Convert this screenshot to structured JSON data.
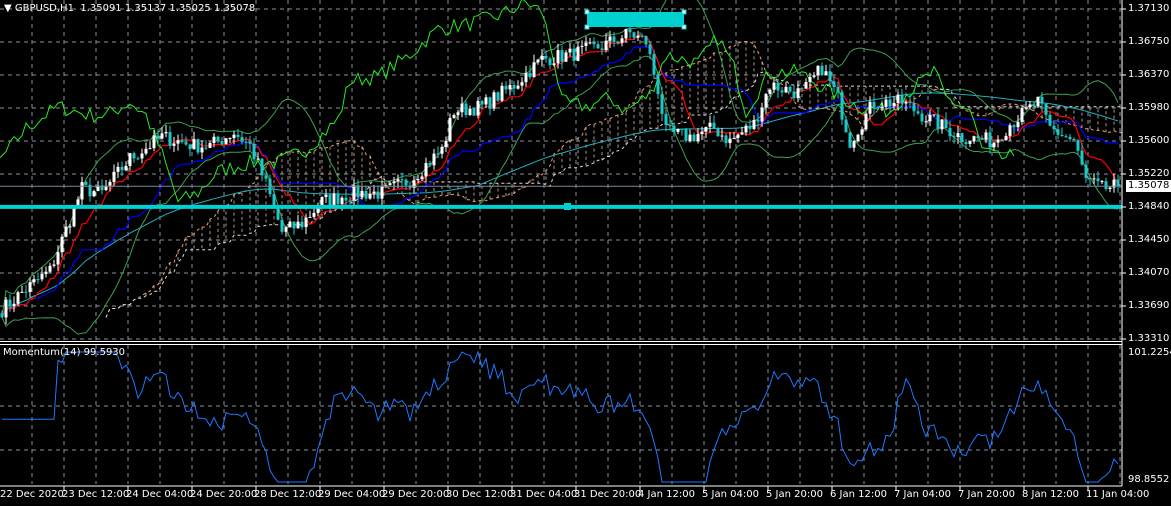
{
  "header": {
    "symbol": "GBPUSD,H1",
    "ohlc": "1.35091 1.35137 1.35025 1.35078",
    "menu_icon": "triangle-down-icon"
  },
  "momentum": {
    "label": "Momentum(14) 99.5930",
    "max_label": "101.2254",
    "min_label": "98.8552"
  },
  "price_axis": {
    "labels": [
      "1.37130",
      "1.36750",
      "1.36370",
      "1.35980",
      "1.35600",
      "1.35220",
      "1.34840",
      "1.34450",
      "1.34070",
      "1.33690",
      "1.33310"
    ],
    "current": "1.35078"
  },
  "time_axis": {
    "labels": [
      "22 Dec 2020",
      "23 Dec 12:00",
      "24 Dec 04:00",
      "24 Dec 20:00",
      "28 Dec 12:00",
      "29 Dec 04:00",
      "29 Dec 20:00",
      "30 Dec 12:00",
      "31 Dec 04:00",
      "31 Dec 20:00",
      "4 Jan 12:00",
      "5 Jan 04:00",
      "5 Jan 20:00",
      "6 Jan 12:00",
      "7 Jan 04:00",
      "7 Jan 20:00",
      "8 Jan 12:00",
      "11 Jan 04:00"
    ]
  },
  "colors": {
    "bull": "#ffffff",
    "bear": "#1ec8c8",
    "grid": "#8a8f99",
    "tenkan": "#ff0000",
    "kijun": "#0000ff",
    "ma_long": "#20b0c0",
    "bands": "#3ca050",
    "oscillator": "#22ee22",
    "cloud": "#f0a070",
    "momentum": "#1e78ff",
    "objects": "#00d0d0"
  },
  "chart_data": {
    "type": "candlestick",
    "symbol": "GBPUSD",
    "timeframe": "H1",
    "ylim": [
      1.3331,
      1.3713
    ],
    "momentum_ylim": [
      98.8552,
      101.2254
    ],
    "hline_price": 1.3484,
    "bars": 280,
    "close_anchors": [
      [
        0,
        1.3365
      ],
      [
        5,
        1.3385
      ],
      [
        12,
        1.341
      ],
      [
        20,
        1.3505
      ],
      [
        25,
        1.35
      ],
      [
        32,
        1.354
      ],
      [
        40,
        1.3565
      ],
      [
        44,
        1.356
      ],
      [
        48,
        1.3555
      ],
      [
        52,
        1.3555
      ],
      [
        58,
        1.357
      ],
      [
        62,
        1.3555
      ],
      [
        66,
        1.351
      ],
      [
        70,
        1.3455
      ],
      [
        75,
        1.3465
      ],
      [
        80,
        1.349
      ],
      [
        88,
        1.35
      ],
      [
        95,
        1.35
      ],
      [
        102,
        1.3515
      ],
      [
        110,
        1.355
      ],
      [
        113,
        1.3595
      ],
      [
        120,
        1.36
      ],
      [
        128,
        1.3625
      ],
      [
        135,
        1.3655
      ],
      [
        142,
        1.366
      ],
      [
        150,
        1.367
      ],
      [
        157,
        1.3685
      ],
      [
        161,
        1.3675
      ],
      [
        164,
        1.362
      ],
      [
        166,
        1.357
      ],
      [
        172,
        1.3565
      ],
      [
        178,
        1.3575
      ],
      [
        182,
        1.356
      ],
      [
        188,
        1.358
      ],
      [
        192,
        1.3625
      ],
      [
        200,
        1.3615
      ],
      [
        205,
        1.3645
      ],
      [
        209,
        1.361
      ],
      [
        212,
        1.356
      ],
      [
        218,
        1.3605
      ],
      [
        225,
        1.3605
      ],
      [
        232,
        1.3585
      ],
      [
        240,
        1.3565
      ],
      [
        248,
        1.356
      ],
      [
        252,
        1.358
      ],
      [
        259,
        1.3605
      ],
      [
        262,
        1.3575
      ],
      [
        268,
        1.356
      ],
      [
        271,
        1.3515
      ],
      [
        275,
        1.3505
      ],
      [
        279,
        1.3508
      ]
    ]
  }
}
